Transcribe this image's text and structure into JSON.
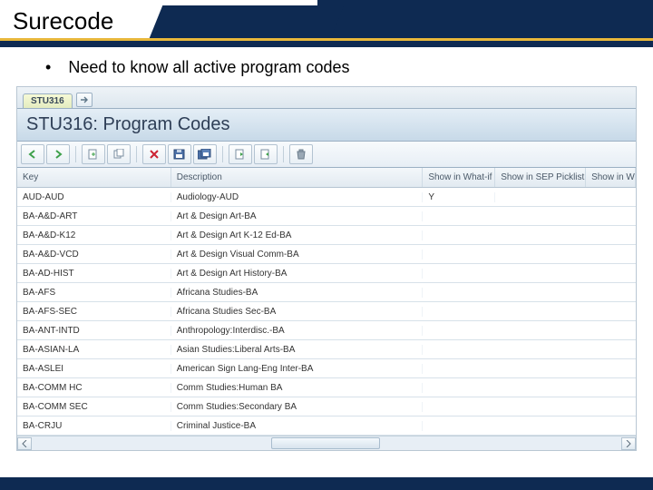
{
  "slide": {
    "title": "Surecode",
    "bullet": "Need to know all active program codes"
  },
  "tab": {
    "label": "STU316"
  },
  "screen": {
    "title": "STU316: Program Codes"
  },
  "columns": {
    "key": "Key",
    "desc": "Description",
    "whatif": "Show in What-if",
    "sep": "Show in SEP Picklist",
    "w3": "Show in W"
  },
  "rows": [
    {
      "key": "AUD-AUD",
      "desc": "Audiology-AUD",
      "whatif": "Y"
    },
    {
      "key": "BA-A&D-ART",
      "desc": "Art & Design Art-BA",
      "whatif": ""
    },
    {
      "key": "BA-A&D-K12",
      "desc": "Art & Design Art K-12 Ed-BA",
      "whatif": ""
    },
    {
      "key": "BA-A&D-VCD",
      "desc": "Art & Design Visual Comm-BA",
      "whatif": ""
    },
    {
      "key": "BA-AD-HIST",
      "desc": "Art & Design Art History-BA",
      "whatif": ""
    },
    {
      "key": "BA-AFS",
      "desc": "Africana Studies-BA",
      "whatif": ""
    },
    {
      "key": "BA-AFS-SEC",
      "desc": "Africana Studies Sec-BA",
      "whatif": ""
    },
    {
      "key": "BA-ANT-INTD",
      "desc": "Anthropology:Interdisc.-BA",
      "whatif": ""
    },
    {
      "key": "BA-ASIAN-LA",
      "desc": "Asian Studies:Liberal Arts-BA",
      "whatif": ""
    },
    {
      "key": "BA-ASLEI",
      "desc": "American Sign Lang-Eng Inter-BA",
      "whatif": ""
    },
    {
      "key": "BA-COMM HC",
      "desc": "Comm Studies:Human BA",
      "whatif": ""
    },
    {
      "key": "BA-COMM SEC",
      "desc": "Comm Studies:Secondary BA",
      "whatif": ""
    },
    {
      "key": "BA-CRJU",
      "desc": "Criminal Justice-BA",
      "whatif": ""
    }
  ]
}
